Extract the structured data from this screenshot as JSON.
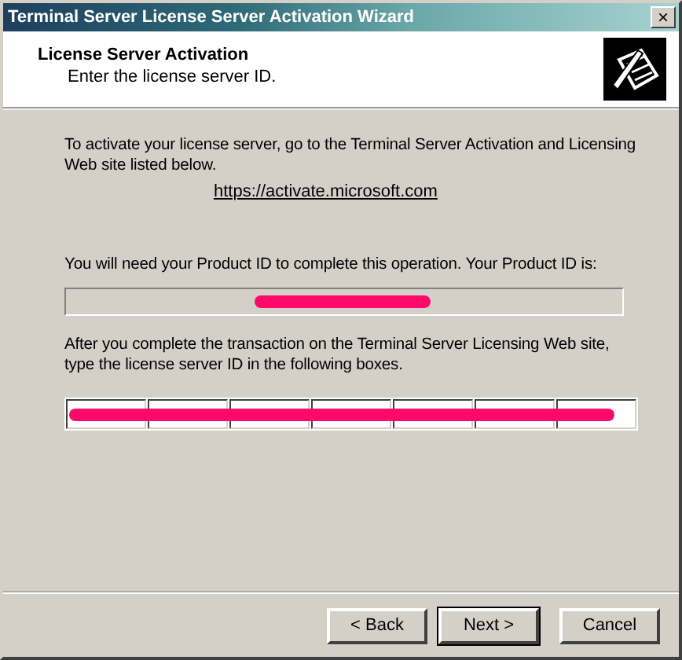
{
  "window": {
    "title": "Terminal Server License Server Activation Wizard",
    "close": "×"
  },
  "header": {
    "title": "License Server Activation",
    "subtitle": "Enter the license server ID."
  },
  "intro": "To activate your license server, go to the Terminal Server Activation and Licensing Web site listed below.",
  "link": "https://activate.microsoft.com",
  "product_id": {
    "label": "You will need your Product ID to complete this operation. Your Product ID is:",
    "redacted": true
  },
  "server_id": {
    "label": "After you complete the transaction on the Terminal Server Licensing Web site, type the license server ID in the following boxes.",
    "redacted": true
  },
  "buttons": [
    {
      "label": "< Back",
      "default": false
    },
    {
      "label": "Next >",
      "default": true
    },
    {
      "label": "Cancel",
      "default": false
    }
  ]
}
